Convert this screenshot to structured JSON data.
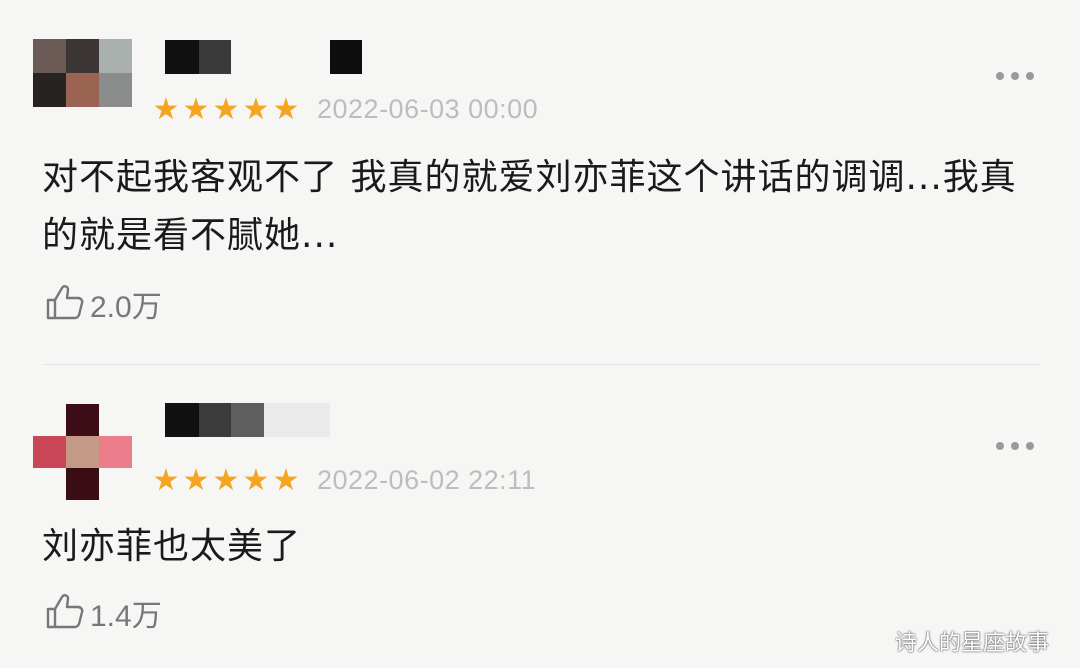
{
  "comments": [
    {
      "date": "2022-06-03 00:00",
      "text": "对不起我客观不了 我真的就爱刘亦菲这个讲话的调调...我真的就是看不腻她...",
      "likes": "2.0万",
      "rating": 5
    },
    {
      "date": "2022-06-02 22:11",
      "text": "刘亦菲也太美了",
      "likes": "1.4万",
      "rating": 5
    }
  ],
  "watermark": "诗人的星座故事",
  "colors": {
    "star": "#f4a521",
    "date": "#bdbdbd",
    "text": "#1a1a1a"
  },
  "icons": {
    "more": "more-dots-icon",
    "like": "thumbs-up-icon",
    "star": "star-icon"
  }
}
